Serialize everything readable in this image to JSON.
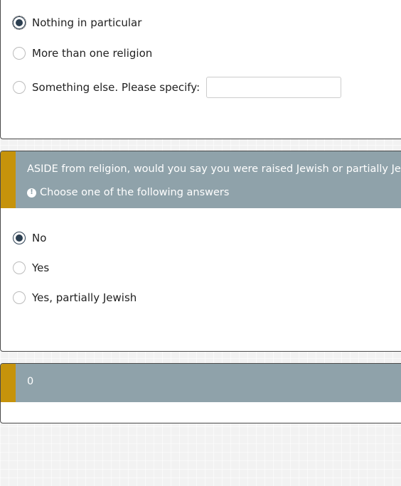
{
  "question_religion": {
    "options": [
      {
        "label": "Nothing in particular",
        "checked": true
      },
      {
        "label": "More than one religion",
        "checked": false
      },
      {
        "label": "Something else. Please specify:",
        "checked": false
      }
    ],
    "other_value": ""
  },
  "question_raised_jewish": {
    "text": "ASIDE from religion, would you say you were raised Jewish or partially Jewish?",
    "tip": "Choose one of the following answers",
    "tip_icon": "exclamation-circle-icon",
    "options": [
      {
        "label": "No",
        "checked": true
      },
      {
        "label": "Yes",
        "checked": false
      },
      {
        "label": "Yes, partially Jewish",
        "checked": false
      }
    ]
  },
  "question_next": {
    "text": "0"
  },
  "colors": {
    "accent": "#c6930b",
    "header_bg": "#8fa2aa",
    "radio_checked": "#2b3e50"
  }
}
